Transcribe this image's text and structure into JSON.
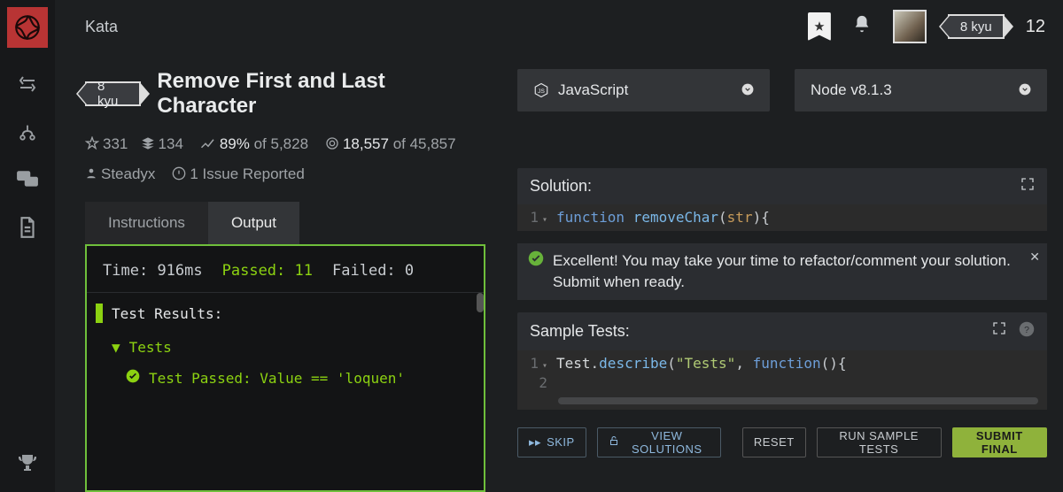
{
  "nav": {
    "kata": "Kata"
  },
  "user": {
    "rank": "8 kyu",
    "honor": "12"
  },
  "kata": {
    "rank": "8 kyu",
    "title": "Remove First and Last Character",
    "stars": "331",
    "collections": "134",
    "satisfaction_pct": "89%",
    "satisfaction_of": "of 5,828",
    "completed": "18,557",
    "completed_of": "of 45,857",
    "author": "Steadyx",
    "issues": "1 Issue Reported"
  },
  "tabs": {
    "instructions": "Instructions",
    "output": "Output"
  },
  "run": {
    "time_label": "Time:",
    "time_value": "916ms",
    "passed_label": "Passed:",
    "passed_value": "11",
    "failed_label": "Failed:",
    "failed_value": "0",
    "results_header": "Test Results:",
    "group": "Tests",
    "test_line": "Test Passed: Value == 'loquen'"
  },
  "selectors": {
    "language": "JavaScript",
    "runtime": "Node v8.1.3"
  },
  "solution": {
    "header": "Solution:",
    "code_line1": "function removeChar(str){"
  },
  "toast": {
    "text": "Excellent! You may take your time to refactor/comment your solution. Submit when ready."
  },
  "sample": {
    "header": "Sample Tests:",
    "code_line1": "Test.describe(\"Tests\", function(){"
  },
  "actions": {
    "skip": "SKIP",
    "view": "VIEW SOLUTIONS",
    "reset": "RESET",
    "run": "RUN SAMPLE TESTS",
    "submit": "SUBMIT FINAL"
  }
}
